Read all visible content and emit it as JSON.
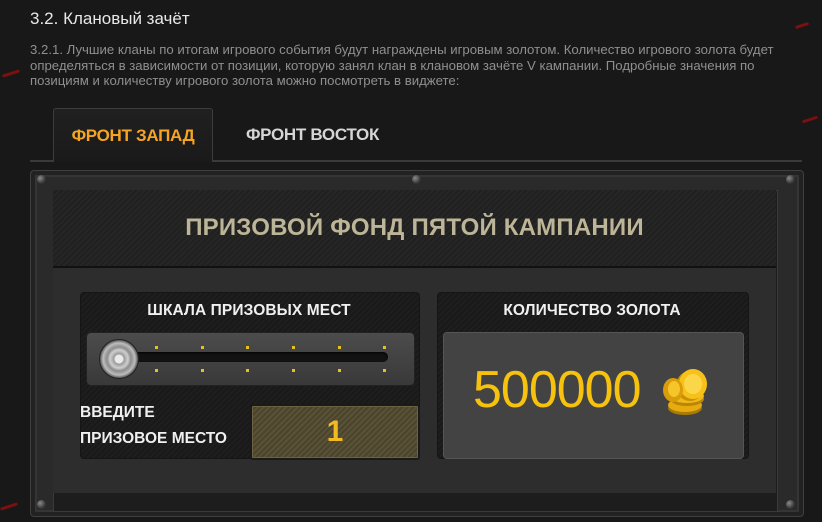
{
  "section": {
    "title": "3.2. Клановый зачёт",
    "text": "3.2.1. Лучшие кланы по итогам игрового события будут награждены игровым золотом. Количество игрового золота будет определяться в зависимости от позиции, которую занял клан в клановом зачёте V кампании. Подробные значения по позициям и количеству игрового золота можно посмотреть в виджете:"
  },
  "tabs": [
    {
      "label": "ФРОНТ ЗАПАД",
      "active": true
    },
    {
      "label": "ФРОНТ ВОСТОК",
      "active": false
    }
  ],
  "widget": {
    "title": "ПРИЗОВОЙ ФОНД ПЯТОЙ КАМПАНИИ",
    "scale_caption": "ШКАЛА ПРИЗОВЫХ МЕСТ",
    "slider_value_fraction": 0.0,
    "place_label_line1": "ВВЕДИТЕ",
    "place_label_line2": "ПРИЗОВОЕ МЕСТО",
    "place_value": "1",
    "gold_caption": "КОЛИЧЕСТВО ЗОЛОТА",
    "gold_amount": "500000",
    "gold_icon": "gold-coins-icon"
  },
  "colors": {
    "accent_orange": "#f6a424",
    "gold": "#f7c20e",
    "fund_title": "#bdb597"
  }
}
